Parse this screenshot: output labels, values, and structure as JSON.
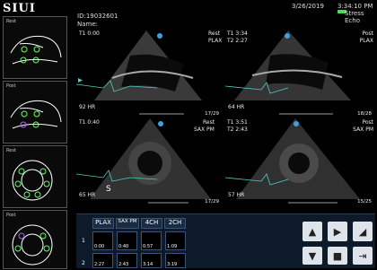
{
  "app": {
    "logo": "SIUI"
  },
  "header": {
    "id": "ID:19032601",
    "name_label": "Name:",
    "date": "3/26/2019",
    "time": "3:34:10 PM",
    "study": "Stress Echo"
  },
  "sidebar": {
    "panels": [
      {
        "label": "Rest"
      },
      {
        "label": "Post"
      },
      {
        "label": "Rest"
      },
      {
        "label": "Post"
      }
    ]
  },
  "quadrants": [
    {
      "phase": "Rest",
      "view": "PLAX",
      "t1": "T1 0:00",
      "t2": "",
      "hr": "92 HR",
      "frames": "17/29"
    },
    {
      "phase": "Post",
      "view": "PLAX",
      "t1": "T1 3:34",
      "t2": "T2 2:27",
      "hr": "64 HR",
      "frames": "18/28"
    },
    {
      "phase": "Rest",
      "view": "SAX PM",
      "t1": "T1 0:40",
      "t2": "",
      "hr": "65 HR",
      "frames": "17/29"
    },
    {
      "phase": "Post",
      "view": "SAX PM",
      "t1": "T1 3:51",
      "t2": "T2 2:43",
      "hr": "57 HR",
      "frames": "15/25"
    }
  ],
  "q3_marker": "S",
  "panel": {
    "tabs": [
      "PLAX",
      "SAX PM",
      "4CH",
      "2CH"
    ],
    "rows": [
      {
        "num": "1",
        "thumbs": [
          "0:00",
          "0:40",
          "0:57",
          "1:09"
        ]
      },
      {
        "num": "2",
        "thumbs": [
          "2:27",
          "2:43",
          "3:14",
          "3:19"
        ]
      }
    ],
    "controls": [
      "up-icon",
      "play-icon",
      "probe-icon",
      "down-icon",
      "stop-icon",
      "exit-icon"
    ]
  },
  "colors": {
    "accent": "#3fa2e0",
    "ecg": "#4ecfc3",
    "status_green": "#4cd964"
  }
}
